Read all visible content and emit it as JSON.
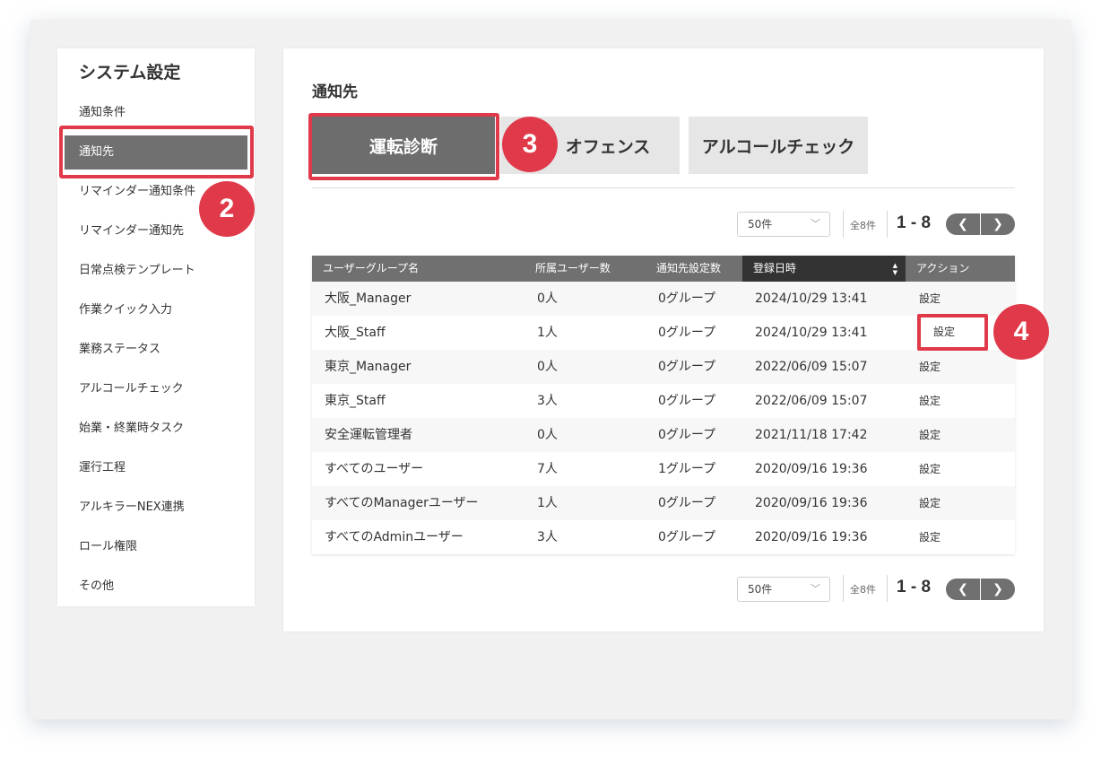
{
  "sidebar": {
    "title": "システム設定",
    "items": [
      {
        "label": "通知条件"
      },
      {
        "label": "通知先"
      },
      {
        "label": "リマインダー通知条件"
      },
      {
        "label": "リマインダー通知先"
      },
      {
        "label": "日常点検テンプレート"
      },
      {
        "label": "作業クイック入力"
      },
      {
        "label": "業務ステータス"
      },
      {
        "label": "アルコールチェック"
      },
      {
        "label": "始業・終業時タスク"
      },
      {
        "label": "運行工程"
      },
      {
        "label": "アルキラーNEX連携"
      },
      {
        "label": "ロール権限"
      },
      {
        "label": "その他"
      }
    ],
    "active_index": 1
  },
  "main": {
    "title": "通知先",
    "tabs": [
      {
        "label": "運転診断"
      },
      {
        "label": "オフェンス"
      },
      {
        "label": "アルコールチェック"
      }
    ]
  },
  "pagination": {
    "per_page": "50件",
    "total": "全8件",
    "range": "1 - 8",
    "prev": "❮",
    "next": "❯"
  },
  "table": {
    "headers": [
      "ユーザーグループ名",
      "所属ユーザー数",
      "通知先設定数",
      "登録日時",
      "アクション"
    ],
    "sorted_column": 3,
    "rows": [
      {
        "name": "大阪_Manager",
        "users": "0人",
        "targets": "0グループ",
        "date": "2024/10/29 13:41",
        "action": "設定"
      },
      {
        "name": "大阪_Staff",
        "users": "1人",
        "targets": "0グループ",
        "date": "2024/10/29 13:41",
        "action": "設定"
      },
      {
        "name": "東京_Manager",
        "users": "0人",
        "targets": "0グループ",
        "date": "2022/06/09 15:07",
        "action": "設定"
      },
      {
        "name": "東京_Staff",
        "users": "3人",
        "targets": "0グループ",
        "date": "2022/06/09 15:07",
        "action": "設定"
      },
      {
        "name": "安全運転管理者",
        "users": "0人",
        "targets": "0グループ",
        "date": "2021/11/18 17:42",
        "action": "設定"
      },
      {
        "name": "すべてのユーザー",
        "users": "7人",
        "targets": "1グループ",
        "date": "2020/09/16 19:36",
        "action": "設定"
      },
      {
        "name": "すべてのManagerユーザー",
        "users": "1人",
        "targets": "0グループ",
        "date": "2020/09/16 19:36",
        "action": "設定"
      },
      {
        "name": "すべてのAdminユーザー",
        "users": "3人",
        "targets": "0グループ",
        "date": "2020/09/16 19:36",
        "action": "設定"
      }
    ]
  },
  "annotations": {
    "step2": "2",
    "step3": "3",
    "step4": "4",
    "color": "#e03a4a"
  }
}
